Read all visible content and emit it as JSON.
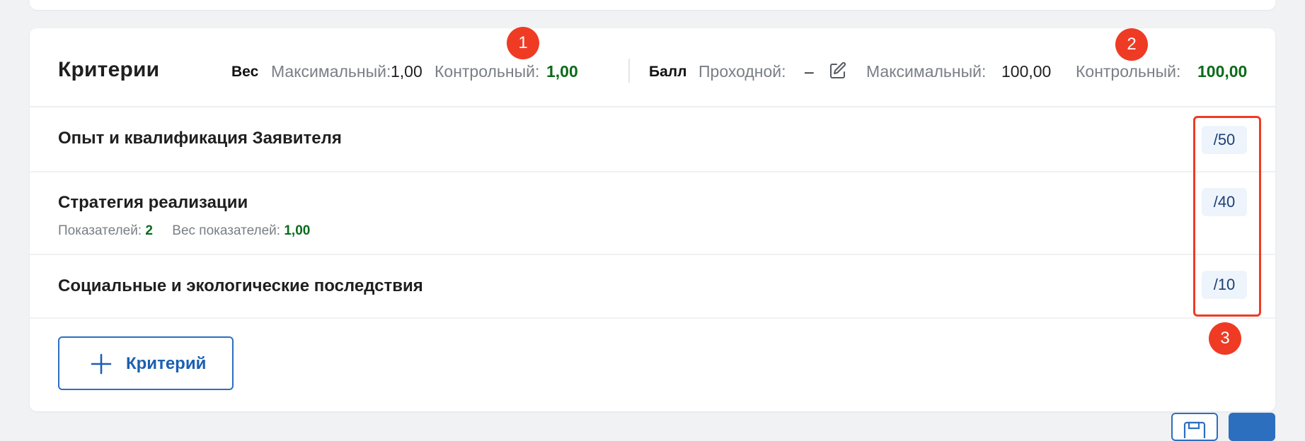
{
  "header": {
    "title": "Критерии",
    "weight": {
      "group_label": "Вес",
      "max_label": "Максимальный:",
      "max_value": "1,00",
      "control_label": "Контрольный:",
      "control_value": "1,00"
    },
    "score": {
      "group_label": "Балл",
      "passing_label": "Проходной:",
      "passing_value": "–",
      "max_label": "Максимальный:",
      "max_value": "100,00",
      "control_label": "Контрольный:",
      "control_value": "100,00"
    }
  },
  "criteria": [
    {
      "title": "Опыт и квалификация Заявителя",
      "max_score": "/50"
    },
    {
      "title": "Стратегия реализации",
      "max_score": "/40",
      "indicators_label": "Показателей:",
      "indicators_value": "2",
      "indicators_weight_label": "Вес показателей:",
      "indicators_weight_value": "1,00"
    },
    {
      "title": "Социальные и экологические последствия",
      "max_score": "/10"
    }
  ],
  "add_button_label": "Критерий",
  "annotations": [
    "1",
    "2",
    "3"
  ],
  "colors": {
    "accent_blue": "#2c6fbf",
    "green_value": "#0b6b1a",
    "annotation_red": "#ef3b24",
    "chip_bg": "#eef4fb"
  },
  "icons": [
    "edit-icon",
    "plus-icon",
    "save-icon"
  ]
}
